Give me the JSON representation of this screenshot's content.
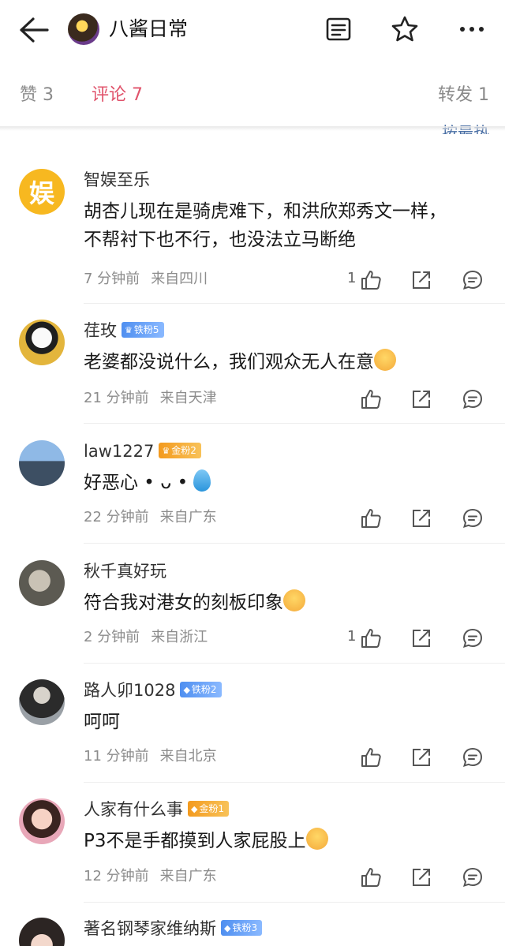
{
  "header": {
    "title": "八酱日常"
  },
  "tabs": {
    "likes": "赞 3",
    "comments": "评论 7",
    "reposts": "转发 1"
  },
  "sort_label": "按最热",
  "comments": [
    {
      "name": "智娱至乐",
      "avatar_text": "娱",
      "badge": "",
      "text": "胡杏儿现在是骑虎难下，和洪欣郑秀文一样，不帮衬下也不行，也没法立马断绝",
      "time": "7 分钟前",
      "location": "来自四川",
      "likes": "1"
    },
    {
      "name": "荏玫",
      "badge": "铁粉5",
      "text": "老婆都没说什么，我们观众无人在意",
      "time": "21 分钟前",
      "location": "来自天津",
      "likes": ""
    },
    {
      "name": "law1227",
      "badge": "金粉2",
      "text": "好恶心 • ᴗ •",
      "time": "22 分钟前",
      "location": "来自广东",
      "likes": ""
    },
    {
      "name": "秋千真好玩",
      "badge": "",
      "text": "符合我对港女的刻板印象",
      "time": "2 分钟前",
      "location": "来自浙江",
      "likes": "1"
    },
    {
      "name": "路人卯1028",
      "badge": "铁粉2",
      "text": "呵呵",
      "time": "11 分钟前",
      "location": "来自北京",
      "likes": ""
    },
    {
      "name": "人家有什么事",
      "badge": "金粉1",
      "text": "P3不是手都摸到人家屁股上",
      "time": "12 分钟前",
      "location": "来自广东",
      "likes": ""
    },
    {
      "name": "著名钢琴家维纳斯",
      "badge": "铁粉3",
      "text": "",
      "time": "",
      "location": "",
      "likes": ""
    }
  ],
  "colors": {
    "accent": "#e0536b",
    "badge_iron": "#6aa7f0",
    "badge_gold": "#f5a62a",
    "text_muted": "#8c8c8c"
  }
}
